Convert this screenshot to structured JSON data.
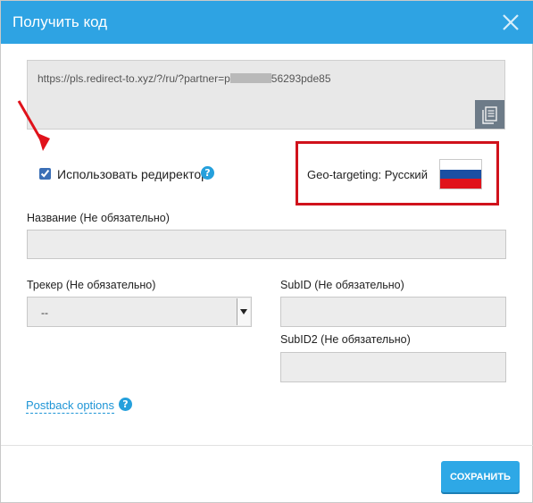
{
  "dialog": {
    "title": "Получить код",
    "header_color": "#2ea3e3"
  },
  "link": {
    "url_prefix": "https://pls.redirect-to.xyz/?/ru/?partner=p",
    "url_suffix": "56293pde85"
  },
  "redirector": {
    "label": "Использовать редиректор",
    "checked": true,
    "help": "?"
  },
  "geo": {
    "label": "Geo-targeting: Русский",
    "flag_colors": [
      "#ffffff",
      "#1a4fa3",
      "#e0121b"
    ],
    "highlight_color": "#d0121b"
  },
  "name_field": {
    "label": "Название (Не обязательно)",
    "value": ""
  },
  "tracker": {
    "label": "Трекер (Не обязательно)",
    "selected": "--"
  },
  "subid": {
    "label": "SubID (Не обязательно)",
    "value": ""
  },
  "subid2": {
    "label": "SubID2 (Не обязательно)",
    "value": ""
  },
  "postback": {
    "label": "Postback options",
    "help": "?"
  },
  "footer": {
    "save_label": "СОХРАНИТЬ"
  },
  "icons": [
    "close-icon",
    "copy-icon",
    "help-icon",
    "red-arrow-icon",
    "flag-icon"
  ]
}
